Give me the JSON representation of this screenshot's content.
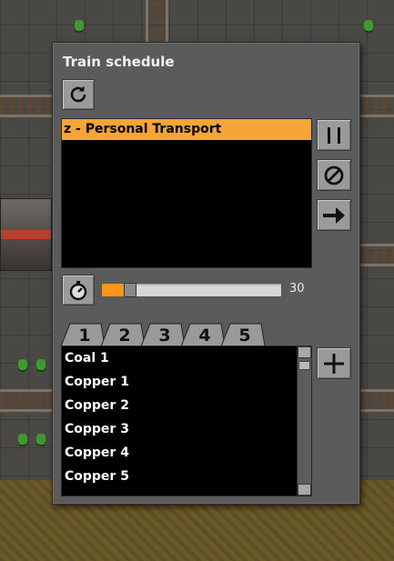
{
  "window": {
    "title": "Train schedule"
  },
  "toolbar": {
    "refresh_icon": "refresh-icon"
  },
  "trains": {
    "selected": 0,
    "items": [
      {
        "label": "z - Personal Transport"
      }
    ]
  },
  "side_buttons": [
    {
      "name": "pause-icon"
    },
    {
      "name": "cancel-icon"
    },
    {
      "name": "arrow-right-icon"
    }
  ],
  "wait": {
    "icon": "stopwatch-icon",
    "value": 30,
    "value_label": "30",
    "fill_fraction": 0.15
  },
  "tabs": [
    "1",
    "2",
    "3",
    "4",
    "5"
  ],
  "schedule": {
    "items": [
      "Coal 1",
      "Copper 1",
      "Copper 2",
      "Copper 3",
      "Copper 4",
      "Copper 5"
    ],
    "add_icon": "plus-icon"
  },
  "colors": {
    "accent": "#f7a336",
    "panel": "#5b5b5b",
    "list_bg": "#000000"
  }
}
